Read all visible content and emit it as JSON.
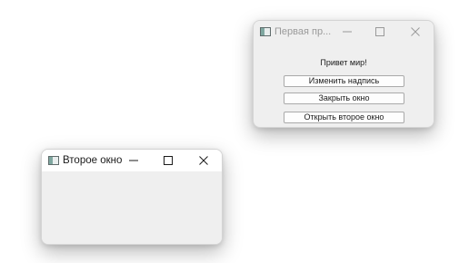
{
  "window_first": {
    "title": "Первая пр...",
    "label": "Привет мир!",
    "buttons": {
      "change_label": "Изменить надпись",
      "close_window": "Закрыть окно",
      "open_second": "Открыть второе окно"
    },
    "icons": {
      "minimize": "minimize-icon",
      "maximize": "maximize-icon",
      "close": "close-icon"
    }
  },
  "window_second": {
    "title": "Второе окно",
    "icons": {
      "minimize": "minimize-icon",
      "maximize": "maximize-icon",
      "close": "close-icon"
    }
  },
  "colors": {
    "window_bg": "#efefef",
    "inactive_title": "#9a9a9a",
    "active_title": "#1b1b1b"
  }
}
